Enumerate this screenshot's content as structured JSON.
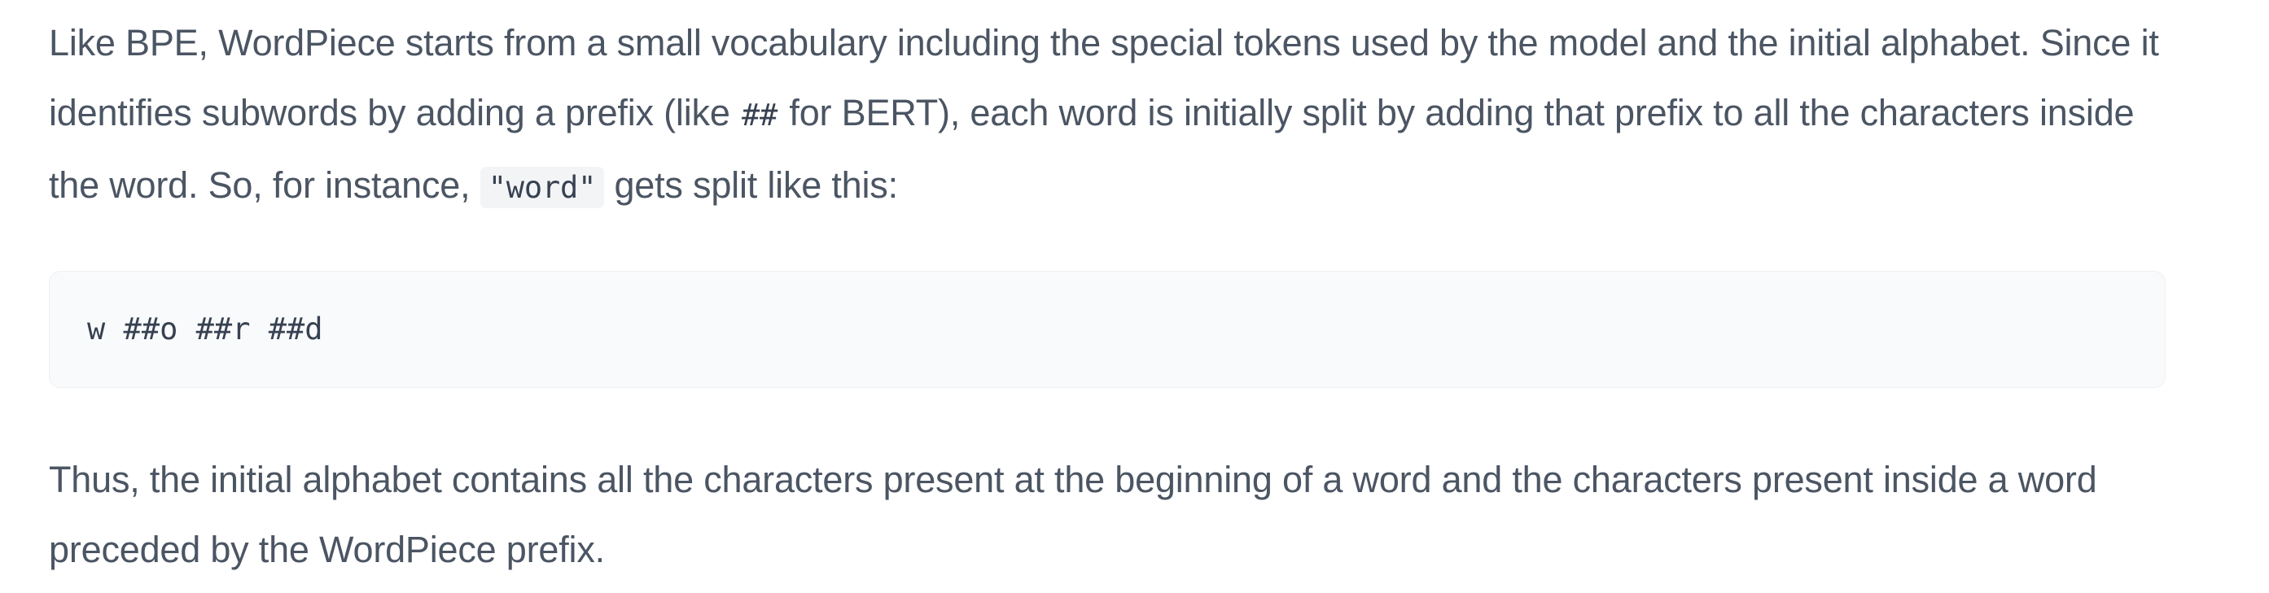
{
  "intro": {
    "part1": "Like BPE, WordPiece starts from a small vocabulary including the special tokens used by the model and the initial alphabet. Since it identifies subwords by adding a prefix (like ",
    "prefix_code": "##",
    "part2": " for BERT), each word is initially split by adding that prefix to all the characters inside the word. So, for instance, ",
    "word_code": "\"word\"",
    "part3": " gets split like this:"
  },
  "code_block": {
    "text": "w ##o ##r ##d"
  },
  "conclusion": {
    "text": "Thus, the initial alphabet contains all the characters present at the beginning of a word and the characters present inside a word preceded by the WordPiece prefix."
  }
}
